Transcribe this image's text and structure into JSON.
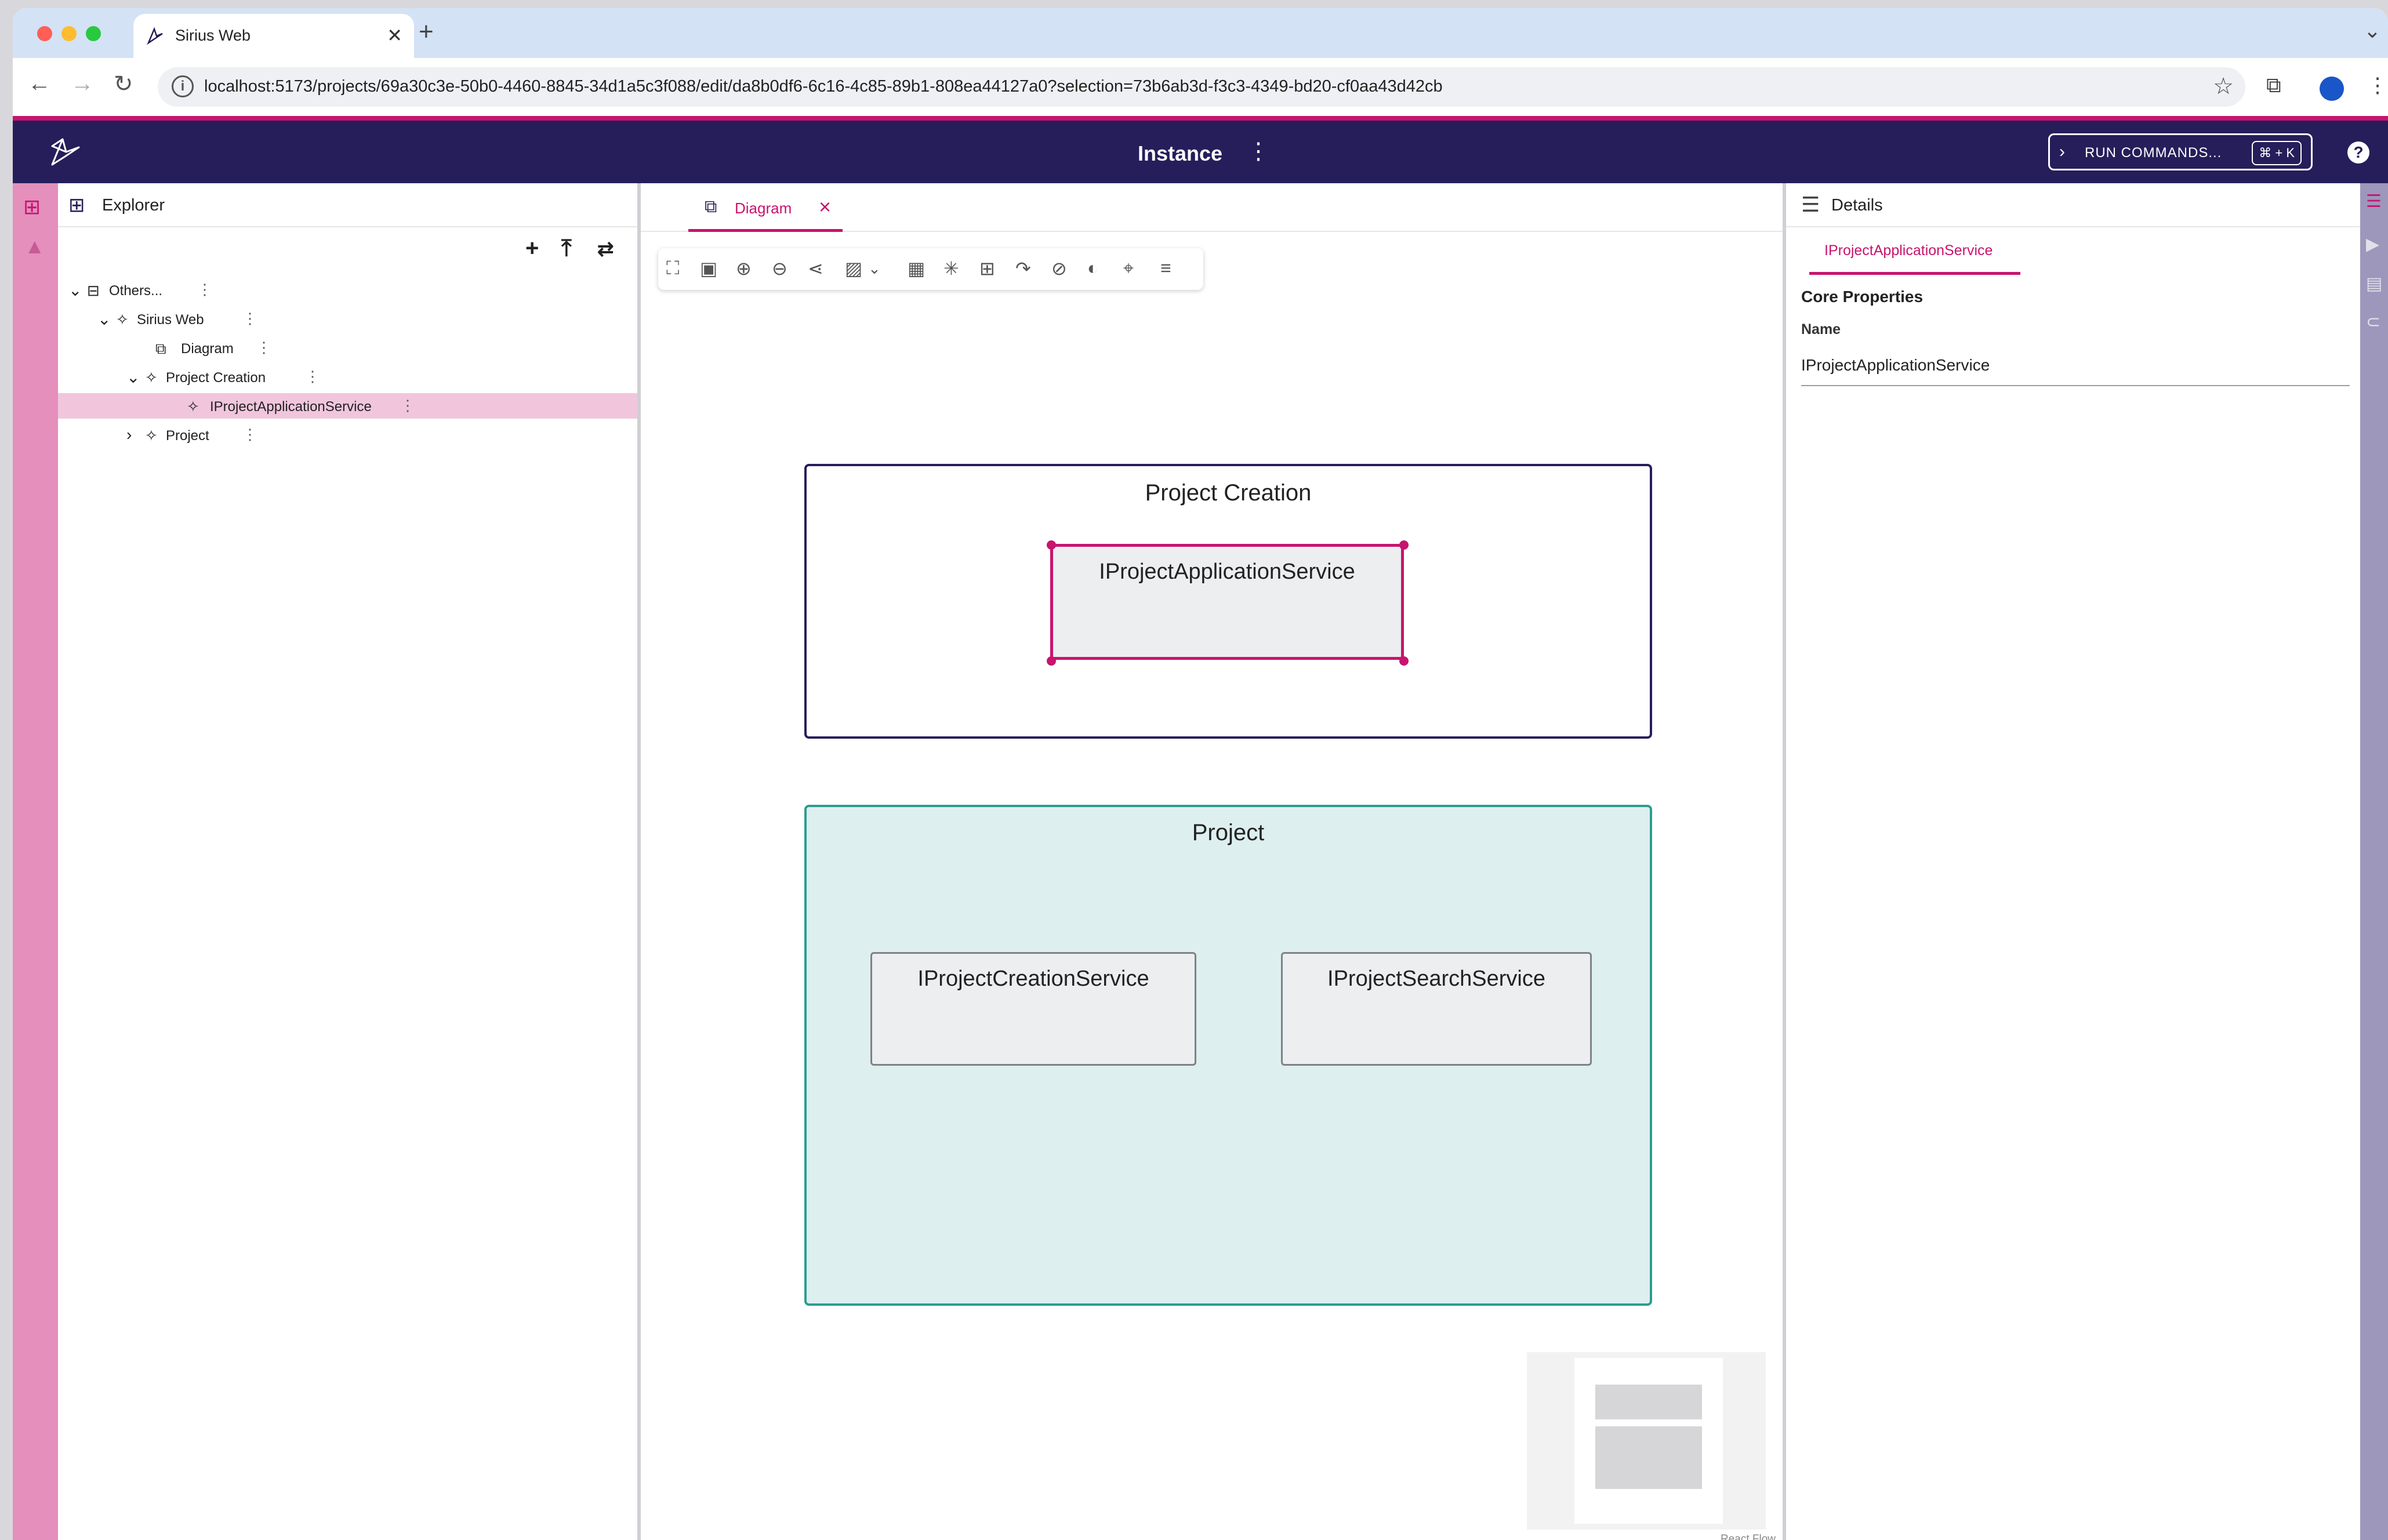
{
  "browser": {
    "tab_title": "Sirius Web",
    "tab_close": "✕",
    "new_tab": "+",
    "url": "localhost:5173/projects/69a30c3e-50b0-4460-8845-34d1a5c3f088/edit/da8b0df6-6c16-4c85-89b1-808ea44127a0?selection=73b6ab3d-f3c3-4349-bd20-cf0aa43d42cb"
  },
  "app": {
    "project_title": "Instance",
    "run_commands_label": "RUN COMMANDS...",
    "run_commands_shortcut": "⌘ + K",
    "help": "?"
  },
  "explorer": {
    "title": "Explorer",
    "tree": [
      {
        "label": "Others...",
        "expanded": true
      },
      {
        "label": "Sirius Web",
        "expanded": true
      },
      {
        "label": "Diagram"
      },
      {
        "label": "Project Creation",
        "expanded": true
      },
      {
        "label": "IProjectApplicationService",
        "selected": true
      },
      {
        "label": "Project",
        "expanded": false
      }
    ]
  },
  "diagram": {
    "tab_label": "Diagram",
    "nodes": {
      "project_creation": "Project Creation",
      "iproject_application_service": "IProjectApplicationService",
      "project": "Project",
      "iproject_creation_service": "IProjectCreationService",
      "iproject_search_service": "IProjectSearchService"
    },
    "attribution": "React Flow"
  },
  "details": {
    "title": "Details",
    "tab_label": "IProjectApplicationService",
    "section": "Core Properties",
    "name_label": "Name",
    "name_value": "IProjectApplicationService"
  },
  "colors": {
    "accent": "#c8146e",
    "header": "#261e5a",
    "project_container": "#ddefee"
  }
}
